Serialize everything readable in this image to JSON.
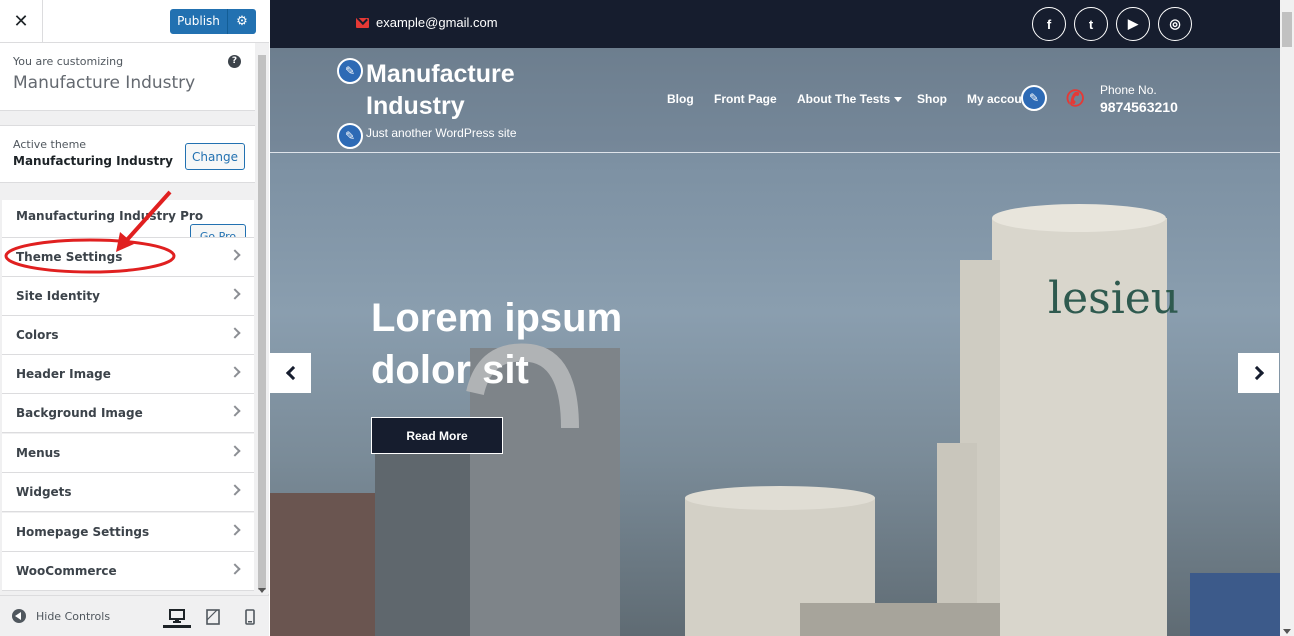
{
  "customizer": {
    "close_icon": "close-icon",
    "publish_label": "Publish",
    "customizing_label": "You are customizing",
    "site_name": "Manufacture Industry",
    "active_theme_label": "Active theme",
    "active_theme_name": "Manufacturing Industry",
    "change_label": "Change",
    "pro_label": "Manufacturing Industry Pro",
    "go_pro_label": "Go Pro",
    "sections": [
      {
        "label": "Theme Settings"
      },
      {
        "label": "Site Identity"
      },
      {
        "label": "Colors"
      },
      {
        "label": "Header Image"
      },
      {
        "label": "Background Image"
      },
      {
        "label": "Menus"
      },
      {
        "label": "Widgets"
      },
      {
        "label": "Homepage Settings"
      },
      {
        "label": "WooCommerce"
      }
    ],
    "hide_controls_label": "Hide Controls",
    "annotation_color": "#e02020"
  },
  "preview": {
    "email": "example@gmail.com",
    "social": [
      "f",
      "t",
      "▶",
      "◎"
    ],
    "site_title": "Manufacture Industry",
    "tagline": "Just another WordPress site",
    "nav": [
      "Blog",
      "Front Page",
      "About The Tests",
      "Shop",
      "My accou"
    ],
    "phone_label": "Phone No.",
    "phone_number": "9874563210",
    "hero_title": "Lorem ipsum dolor sit",
    "read_more": "Read More",
    "accent": "#e53935",
    "dark": "#161d2e"
  }
}
